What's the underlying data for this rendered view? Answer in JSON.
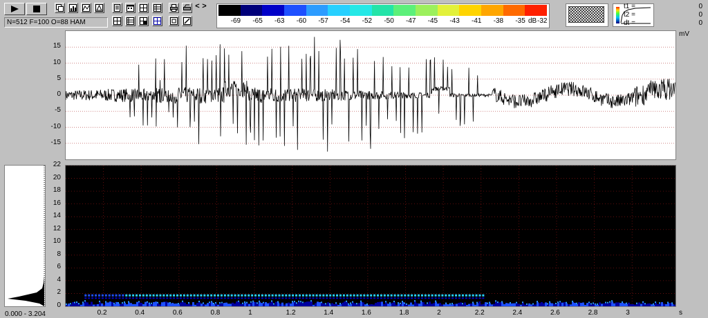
{
  "toolbar": {
    "play_label": "play",
    "stop_label": "stop",
    "params": "N=512 F=100 O=88 HAM",
    "nav_left": "<",
    "nav_right": ">"
  },
  "colorbar": {
    "labels": [
      "-69",
      "-65",
      "-63",
      "-60",
      "-57",
      "-54",
      "-52",
      "-50",
      "-47",
      "-45",
      "-43",
      "-41",
      "-38",
      "-35",
      "-32"
    ],
    "unit": "dB",
    "colors": [
      "#000000",
      "#00007a",
      "#0000c8",
      "#1e50ff",
      "#2c9cff",
      "#27d0ff",
      "#25e8e6",
      "#24e4a8",
      "#5cf07a",
      "#9cf05c",
      "#e2f13a",
      "#ffd400",
      "#ffa600",
      "#ff6a00",
      "#ff2000"
    ]
  },
  "time_readout": {
    "t1_label": "t1 =",
    "t1_value": "0",
    "t2_label": "t2 =",
    "t2_value": "0",
    "dt_label": "dt =",
    "dt_value": "0"
  },
  "side_panel": {
    "range_label": "0.000 - 3.204"
  },
  "chart_data": [
    {
      "type": "line",
      "title": "",
      "unit": "mV",
      "ylim": [
        -20,
        20
      ],
      "yticks": [
        15,
        10,
        5,
        0,
        -5,
        -10,
        -15
      ],
      "grid": true,
      "xlim": [
        0,
        3.3
      ]
    },
    {
      "type": "heatmap",
      "ylim": [
        0,
        22
      ],
      "yticks": [
        22,
        20,
        18,
        16,
        14,
        12,
        10,
        8,
        6,
        4,
        2,
        0
      ],
      "xticks": [
        0.2,
        0.4,
        0.6,
        0.8,
        1,
        1.2,
        1.4,
        1.6,
        1.8,
        2,
        2.2,
        2.4,
        2.6,
        2.8,
        3
      ],
      "xlabel": "s",
      "xlim": [
        0,
        3.23
      ],
      "harmonic_band": {
        "y": 1.7,
        "x_start": 0.1,
        "x_end": 2.22
      }
    }
  ]
}
